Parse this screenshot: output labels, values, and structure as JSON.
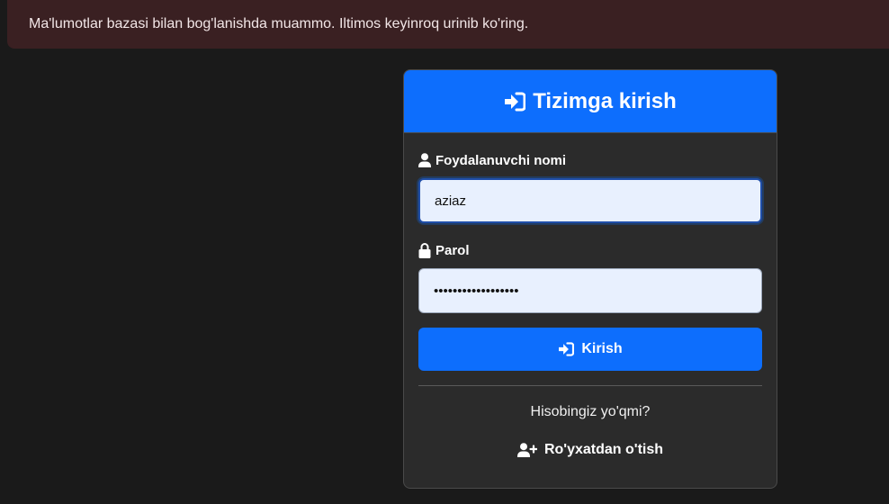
{
  "alert": {
    "message": "Ma'lumotlar bazasi bilan bog'lanishda muammo. Iltimos keyinroq urinib ko'ring."
  },
  "login": {
    "title": "Tizimga kirish",
    "title_icon": "sign-in-icon",
    "username": {
      "label": "Foydalanuvchi nomi",
      "icon": "user-icon",
      "value": "aziaz"
    },
    "password": {
      "label": "Parol",
      "icon": "lock-icon",
      "value": "••••••••••••••••••"
    },
    "submit": {
      "label": "Kirish",
      "icon": "sign-in-icon"
    },
    "no_account_text": "Hisobingiz yo'qmi?",
    "register": {
      "label": "Ro'yxatdan o'tish",
      "icon": "user-plus-icon"
    }
  },
  "colors": {
    "background": "#1a1a1a",
    "alert_bg": "#3a2022",
    "primary": "#0d6efd",
    "card_bg": "#2b2b2b",
    "input_bg": "#e8f0fe"
  }
}
